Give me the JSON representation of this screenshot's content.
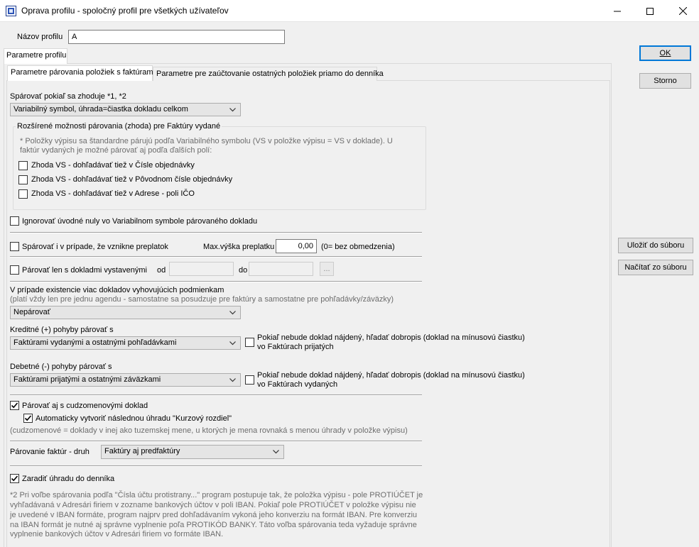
{
  "window": {
    "title": "Oprava profilu - spoločný profil pre všetkých užívateľov"
  },
  "profile_name": {
    "label": "Názov profilu",
    "value": "A"
  },
  "outer_tab": {
    "label": "Parametre profilu"
  },
  "inner_tabs": [
    {
      "label": "Parametre párovania položiek s faktúrami",
      "active": true
    },
    {
      "label": "Parametre pre zaúčtovanie ostatných položiek priamo do denníka",
      "active": false
    }
  ],
  "buttons": {
    "ok": "OK",
    "cancel": "Storno",
    "save_to_file": "Uložiť do súboru",
    "load_from_file": "Načítať zo súboru",
    "browse": "..."
  },
  "match": {
    "label": "Spárovať pokiaľ sa zhoduje *1, *2",
    "selected": "Variabilný symbol, úhrada=čiastka dokladu celkom"
  },
  "extended": {
    "title": "Rozšírené možnosti párovania (zhoda) pre Faktúry vydané",
    "note_line1": "* Položky výpisu sa štandardne párujú podľa Variabilného symbolu (VS v položke výpisu = VS v doklade). U",
    "note_line2": "faktúr vydaných je možné párovať aj podľa ďalších polí:",
    "options": [
      {
        "label": "Zhoda VS - dohľadávať tiež v Čísle objednávky",
        "checked": false
      },
      {
        "label": "Zhoda VS - dohľadávať tiež v Pôvodnom čísle objednávky",
        "checked": false
      },
      {
        "label": "Zhoda VS - dohľadávať tiež v Adrese - poli IČO",
        "checked": false
      }
    ]
  },
  "ignore_zeros": {
    "label": "Ignorovať úvodné nuly vo Variabilnom symbole párovaného dokladu",
    "checked": false
  },
  "overpay": {
    "label": "Spárovať i v prípade, že vznikne preplatok",
    "checked": false,
    "max_label": "Max.výška preplatku",
    "max_value": "0,00",
    "max_hint": "(0= bez obmedzenia)"
  },
  "date_range": {
    "label": "Párovať len s dokladmi vystavenými",
    "checked": false,
    "from_label": "od",
    "to_label": "do",
    "from_value": "",
    "to_value": ""
  },
  "multiple": {
    "label": "V prípade existencie viac dokladov vyhovujúcich podmienkam",
    "note": "(platí vždy len pre jednu agendu - samostatne sa posudzuje pre faktúry a samostatne pre pohľadávky/záväzky)",
    "selected": "Nepárovať"
  },
  "credit": {
    "label": "Kreditné (+) pohyby párovať s",
    "selected": "Faktúrami vydanými a ostatnými pohľadávkami",
    "fallback_line1": "Pokiaľ nebude doklad nájdený, hľadať dobropis (doklad na mínusovú čiastku)",
    "fallback_line2": "vo Faktúrach prijatých",
    "fallback_checked": false
  },
  "debit": {
    "label": "Debetné (-) pohyby párovať s",
    "selected": "Faktúrami prijatými a ostatnými záväzkami",
    "fallback_line1": "Pokiaľ nebude doklad nájdený, hľadať dobropis (doklad na mínusovú čiastku)",
    "fallback_line2": "vo Faktúrach vydaných",
    "fallback_checked": false
  },
  "foreign": {
    "label": "Párovať aj s cudzomenovými doklad",
    "checked": true,
    "auto_label": "Automaticky vytvoriť následnou úhradu \"Kurzový rozdiel\"",
    "auto_checked": true,
    "note": "(cudzomenové = doklady v inej ako tuzemskej mene, u ktorých je mena rovnaká s menou úhrady v položke výpisu)"
  },
  "invoice_kind": {
    "label": "Párovanie faktúr - druh",
    "selected": "Faktúry aj predfaktúry"
  },
  "journal": {
    "label": "Zaradiť úhradu do denníka",
    "checked": true
  },
  "footnote": [
    "*2 Pri voľbe spárovania podľa \"Čísla účtu protistrany...\" program postupuje tak, že položka výpisu - pole PROTIÚČET je",
    "vyhľadávaná v Adresári firiem v zozname bankových účtov v poli IBAN. Pokiaľ pole PROTIÚČET v položke výpisu nie",
    "je uvedené v IBAN formáte, program najprv pred dohľadávaním vykoná jeho konverziu na formát IBAN. Pre konverziu",
    "na IBAN formát je nutné aj správne vyplnenie poľa PROTIKÓD BANKY. Táto voľba spárovania teda vyžaduje správne",
    "vyplnenie bankových účtov v Adresári firiem vo formáte IBAN."
  ]
}
